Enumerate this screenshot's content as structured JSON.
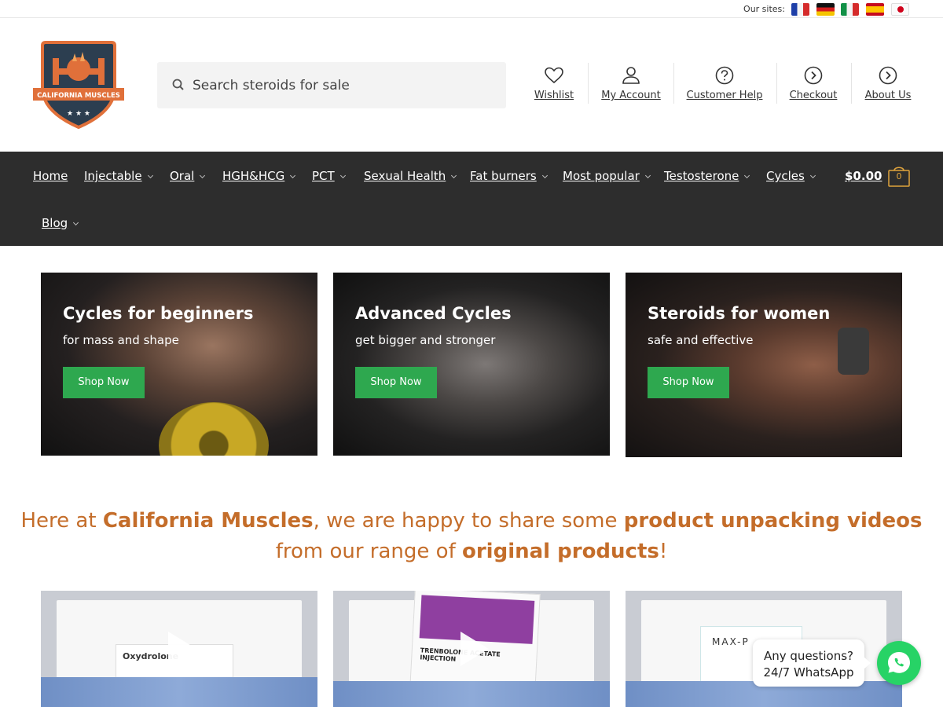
{
  "topbar": {
    "our_sites_label": "Our sites:",
    "flags": [
      "fr-flag",
      "de-flag",
      "it-flag",
      "es-flag",
      "jp-flag"
    ]
  },
  "brand": {
    "logo_text": "CALIFORNIA MUSCLES",
    "colors": {
      "accent": "#c46d2a",
      "badge_dark": "#2c3e50",
      "badge_orange": "#e0703a",
      "button_green": "#2ea84f"
    }
  },
  "search": {
    "placeholder": "Search steroids for sale",
    "icon": "search-icon"
  },
  "header_links": [
    {
      "label": "Wishlist",
      "icon": "heart-icon"
    },
    {
      "label": "My Account",
      "icon": "user-icon"
    },
    {
      "label": "Customer Help",
      "icon": "question-icon"
    },
    {
      "label": "Checkout",
      "icon": "arrow-right-circle-icon"
    },
    {
      "label": "About Us",
      "icon": "chevron-right-circle-icon"
    }
  ],
  "nav": {
    "items": [
      "Home",
      "Injectable",
      "Oral",
      "HGH&HCG",
      "PCT",
      "Sexual Health",
      "Fat burners",
      "Most popular",
      "Testosterone",
      "Cycles",
      "Blog"
    ],
    "cart_total": "$0.00",
    "cart_count": "0"
  },
  "promos": [
    {
      "title": "Cycles for beginners",
      "subtitle": "for mass and shape",
      "button": "Shop Now"
    },
    {
      "title": "Advanced Cycles",
      "subtitle": "get bigger and stronger",
      "button": "Shop Now"
    },
    {
      "title": "Steroids for women",
      "subtitle": "safe and effective",
      "button": "Shop Now"
    }
  ],
  "headline": {
    "part1": "Here at ",
    "brand": "California Muscles",
    "part2": ", we are happy to share some ",
    "highlight1": "product unpacking videos",
    "part3": "from our range of ",
    "highlight2": "original products",
    "part4": "!"
  },
  "videos": [
    {
      "product": "Oxydrolone"
    },
    {
      "product": "TRENBOLONE ACETATE INJECTION"
    },
    {
      "product": "MAX-P"
    }
  ],
  "whatsapp": {
    "line1": "Any questions?",
    "line2": "24/7 WhatsApp"
  }
}
